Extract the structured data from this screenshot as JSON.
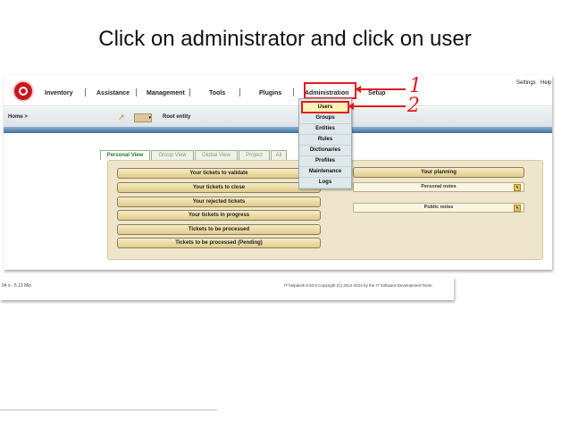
{
  "slide": {
    "title": "Click on administrator and click on user"
  },
  "menu": {
    "items": [
      "Inventory",
      "Assistance",
      "Management",
      "Tools",
      "Plugins",
      "Administration",
      "Setup"
    ],
    "links": [
      "Settings",
      "Help"
    ]
  },
  "breadcrumb": {
    "home": "Home >",
    "entity": "Root entity"
  },
  "tabs": [
    "Personal View",
    "Group View",
    "Global View",
    "Project",
    "All"
  ],
  "dashboard": {
    "left_buttons": [
      "Your tickets to validate",
      "Your tickets to close",
      "Your rejected tickets",
      "Your tickets in progress",
      "Tickets to be processed",
      "Tickets to be processed (Pending)"
    ],
    "planning": "Your planning",
    "notes": [
      "Personal notes",
      "Public notes"
    ]
  },
  "admin_menu": [
    "Users",
    "Groups",
    "Entities",
    "Rules",
    "Dictionaries",
    "Profiles",
    "Maintenance",
    "Logs"
  ],
  "annotations": [
    "1",
    "2"
  ],
  "footer": {
    "left": "04 s - 5.13 Mio",
    "right": "IT helpdesk 8.83.5 Copyright (C) 2012-2014 by the IT Software Development Team."
  },
  "colors": {
    "annotation": "#e01b1b",
    "panel": "#eee5cc",
    "blue_bar": "#3f6f9c"
  }
}
